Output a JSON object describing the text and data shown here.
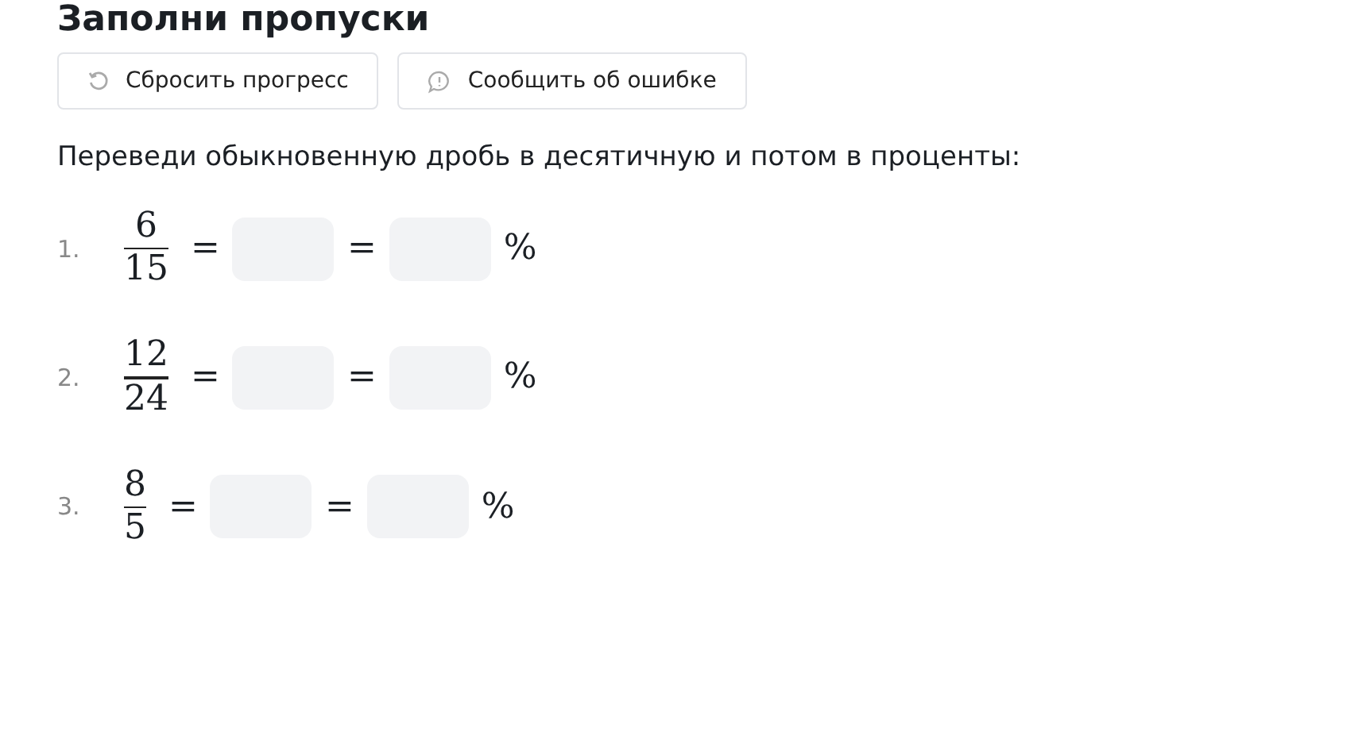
{
  "title": "Заполни пропуски",
  "buttons": [
    {
      "label": "Сбросить прогресс",
      "kind": "reset"
    },
    {
      "label": "Сообщить об ошибке",
      "kind": "report"
    }
  ],
  "instruction": "Переведи обыкновенную дробь в десятичную и потом в проценты:",
  "items": [
    {
      "number": "1.",
      "numerator": "6",
      "denominator": "15",
      "equals": "=",
      "percent": "%"
    },
    {
      "number": "2.",
      "numerator": "12",
      "denominator": "24",
      "equals": "=",
      "percent": "%"
    },
    {
      "number": "3.",
      "numerator": "8",
      "denominator": "5",
      "equals": "=",
      "percent": "%"
    }
  ]
}
